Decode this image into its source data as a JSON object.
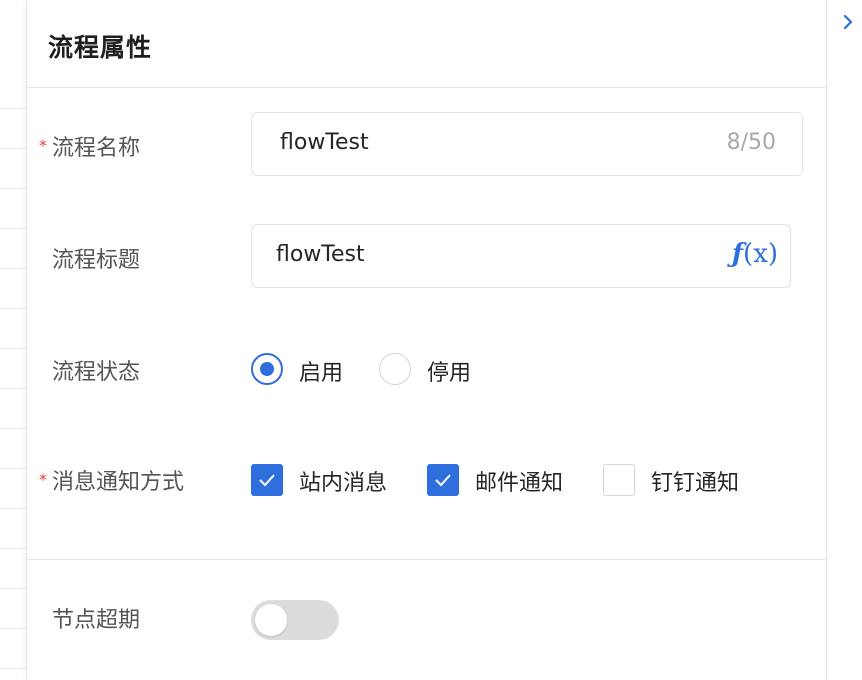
{
  "panel": {
    "title": "流程属性"
  },
  "form": {
    "flow_name": {
      "label": "流程名称",
      "required_mark": "*",
      "value": "flowTest",
      "count": "8/50"
    },
    "flow_title": {
      "label": "流程标题",
      "value": "flowTest",
      "fx_f": "ƒ",
      "fx_x": "(x)"
    },
    "flow_status": {
      "label": "流程状态",
      "options": [
        {
          "label": "启用",
          "checked": true
        },
        {
          "label": "停用",
          "checked": false
        }
      ]
    },
    "notify": {
      "label": "消息通知方式",
      "required_mark": "*",
      "options": [
        {
          "label": "站内消息",
          "checked": true
        },
        {
          "label": "邮件通知",
          "checked": true
        },
        {
          "label": "钉钉通知",
          "checked": false
        }
      ]
    },
    "node_timeout": {
      "label": "节点超期",
      "enabled": false
    }
  },
  "icons": {
    "collapse": "chevron-right-icon",
    "check": "check-icon",
    "formula": "fx-icon"
  },
  "colors": {
    "accent": "#2f6fdd",
    "required": "#e5403a",
    "border": "#e3e3e3",
    "toggle_off": "#dcdcdf"
  }
}
